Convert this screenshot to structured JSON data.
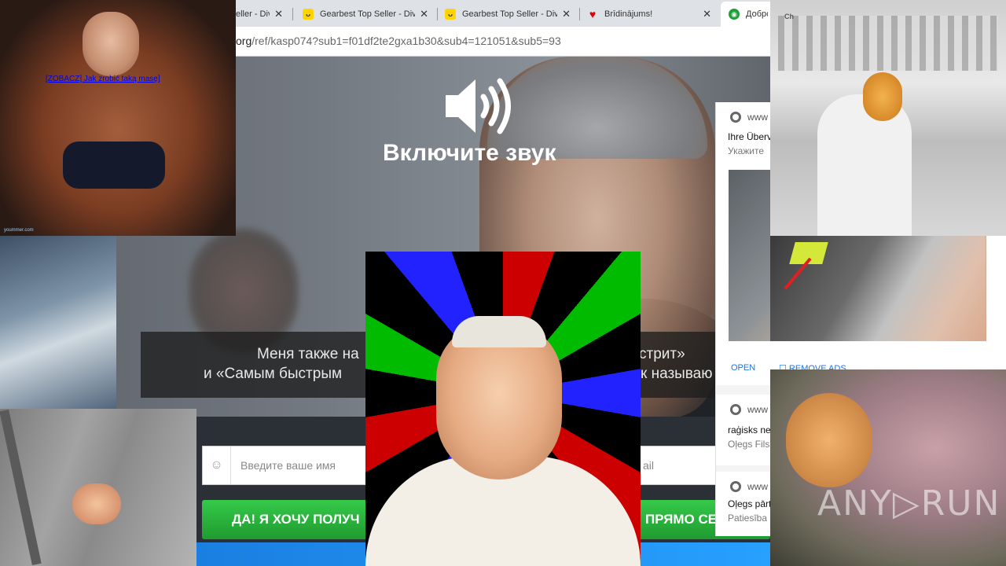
{
  "browser": {
    "tabs": [
      {
        "label": "eller - Div",
        "icon": "gearbest-icon"
      },
      {
        "label": "Gearbest Top Seller - Div",
        "icon": "gearbest-icon"
      },
      {
        "label": "Gearbest Top Seller - Div",
        "icon": "gearbest-icon"
      },
      {
        "label": "Brīdinājums!",
        "icon": "heart-icon"
      },
      {
        "label": "Добро",
        "icon": "site-icon"
      }
    ],
    "close_glyph": "✕",
    "url_visible": "org",
    "url_path": "/ref/kasp074?sub1=f01df2te2gxa1b30&sub4=121051&sub5=93"
  },
  "page": {
    "sound_prompt": "Включите звук",
    "subtitle_line1_left": "Меня также на",
    "subtitle_line1_right": "стрит»",
    "subtitle_line2_left": "и «Самым быстрым",
    "subtitle_line2_right": "к называю",
    "name_placeholder": "Введите ваше имя",
    "email_placeholder_fragment": "ail",
    "cta_left": "ДА! Я ХОЧУ ПОЛУЧ",
    "cta_right": "ПРЯМО СЕ"
  },
  "notifications": {
    "items": [
      {
        "source": "www",
        "title": "Ihre Überv",
        "body": "Укажите"
      },
      {
        "source": "www",
        "title": "raģisks nel",
        "body": "Oļegs Fils :"
      },
      {
        "source": "www",
        "title": "Oļegs pārt",
        "body": "Patiesība n"
      }
    ],
    "open_label": "OPEN",
    "remove_label": "REMOVE ADS"
  },
  "overlays": {
    "bodybuilder_link": "[ZOBACZ] Jak zrobić taką masę]",
    "bodybuilder_watermark": "yoummer.com",
    "shop_brand": "Ch"
  },
  "watermark": "ANY▷RUN",
  "colors": {
    "cta_green": "#2bb53e",
    "link_blue": "#1a73e8",
    "tabbar": "#dee1e6"
  }
}
